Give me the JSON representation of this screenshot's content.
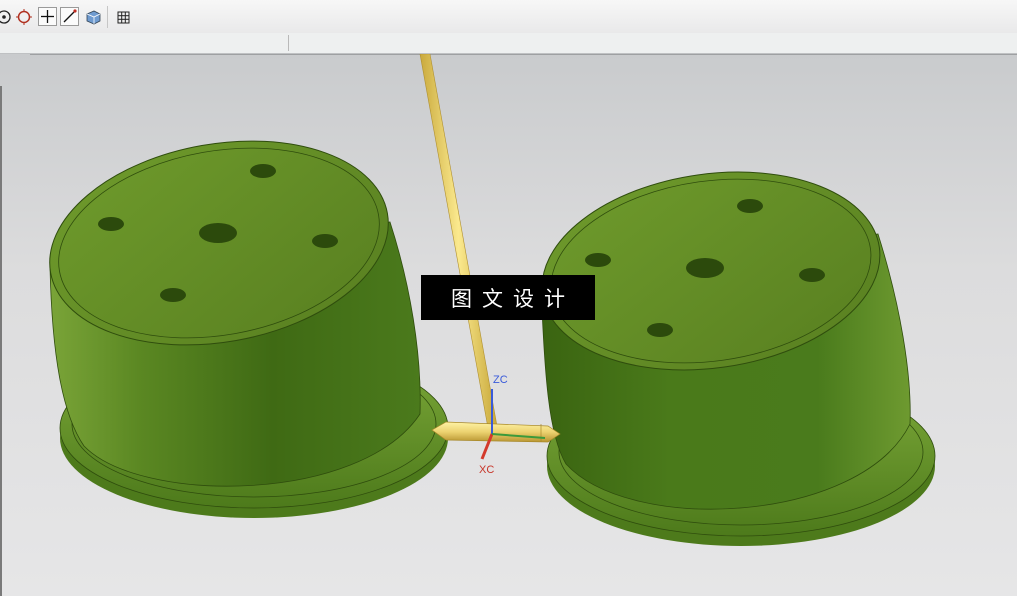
{
  "toolbar": {
    "buttons": [
      {
        "icon": "target-icon"
      },
      {
        "icon": "circle-snap-icon"
      },
      {
        "icon": "crosshair-icon"
      },
      {
        "icon": "line-icon"
      },
      {
        "icon": "cube-view-icon"
      },
      {
        "icon": "grid-icon"
      }
    ]
  },
  "viewport": {
    "axis_labels": {
      "z": "ZC",
      "x": "XC"
    },
    "watermark": "图文设计",
    "colors": {
      "part_green": "#4f7a1f",
      "runner_yellow": "#e8d270",
      "z_axis": "#3a5bd9",
      "x_axis": "#d33a2c",
      "y_axis": "#3b9a3b"
    }
  }
}
